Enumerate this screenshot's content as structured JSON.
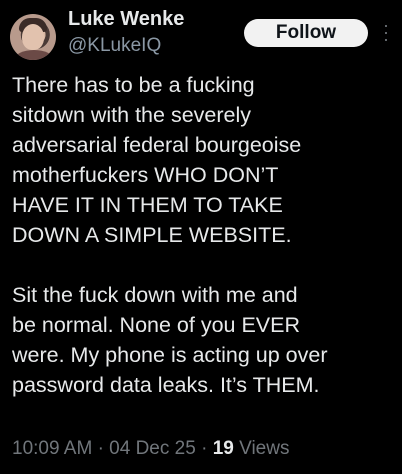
{
  "author": {
    "name": "Luke Wenke",
    "handle": "@KLukeIQ",
    "avatar_icon": "profile-photo"
  },
  "follow_label": "Follow",
  "more_icon": "more-options-icon",
  "post": {
    "lines_1": [
      "There has to be a fucking",
      "sitdown with the severely",
      "adversarial federal bourgeoise",
      "motherfuckers WHO DON’T",
      "HAVE IT IN THEM TO TAKE",
      "DOWN A SIMPLE WEBSITE."
    ],
    "lines_2": [
      "Sit the fuck down with me and",
      "be normal.  None of you EVER",
      "were.  My phone is acting up over",
      "password data leaks.  It’s THEM."
    ]
  },
  "meta": {
    "time": "10:09 AM",
    "date": "04 Dec 25",
    "views_count": "19",
    "views_label": "Views",
    "separator": "·"
  },
  "colors": {
    "background": "#000000",
    "text": "#e7e9ea",
    "secondary": "#71767b",
    "button_bg": "#f2f2f2"
  }
}
